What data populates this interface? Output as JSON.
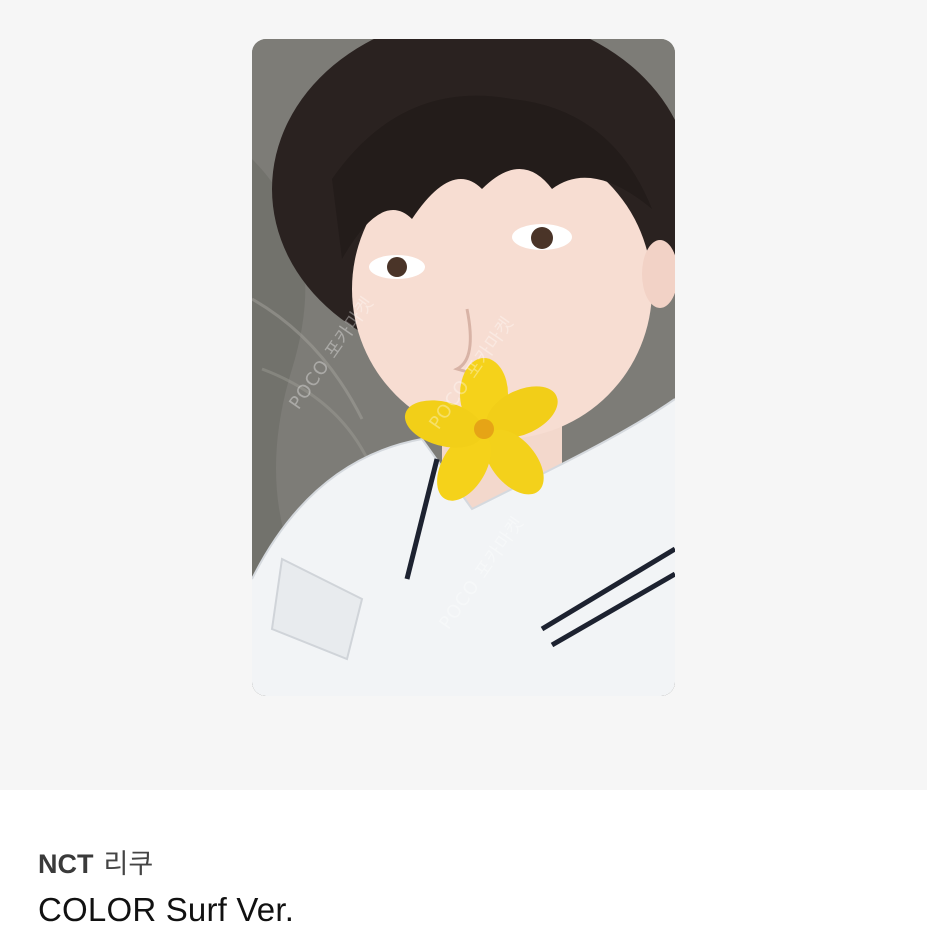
{
  "product": {
    "brand": "NCT",
    "member": "리쿠",
    "title": "COLOR Surf Ver."
  },
  "photocard": {
    "watermark": "POCO 포카마켓",
    "alt": "photocard-image"
  },
  "colors": {
    "background": "#f6f6f6",
    "info_background": "#ffffff",
    "flower": "#f5d21a",
    "shirt": "#f2f4f6"
  }
}
